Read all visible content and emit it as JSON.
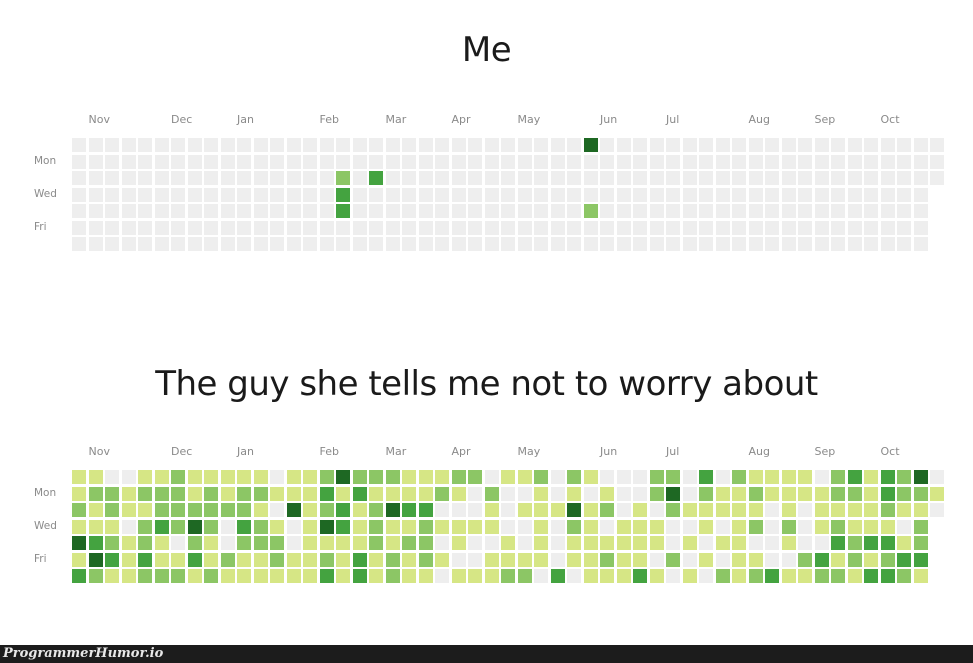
{
  "chart_data": [
    {
      "type": "heatmap",
      "title": "Me",
      "months": [
        "Nov",
        "Dec",
        "Jan",
        "Feb",
        "Mar",
        "Apr",
        "May",
        "Jun",
        "Jul",
        "Aug",
        "Sep",
        "Oct"
      ],
      "month_start_week": [
        1,
        6,
        10,
        15,
        19,
        23,
        27,
        32,
        36,
        41,
        45,
        49
      ],
      "weekday_labels": [
        {
          "row": 1,
          "label": "Mon"
        },
        {
          "row": 3,
          "label": "Wed"
        },
        {
          "row": 5,
          "label": "Fri"
        }
      ],
      "weeks": 53,
      "last_week_days": 3,
      "levels": [
        "#eeeeee",
        "#d6e685",
        "#8cc665",
        "#44a340",
        "#1e6823"
      ],
      "active_cells": [
        {
          "week": 16,
          "day": 2,
          "level": 2
        },
        {
          "week": 16,
          "day": 3,
          "level": 3
        },
        {
          "week": 16,
          "day": 4,
          "level": 3
        },
        {
          "week": 18,
          "day": 2,
          "level": 3
        },
        {
          "week": 31,
          "day": 0,
          "level": 4
        },
        {
          "week": 31,
          "day": 4,
          "level": 2
        }
      ]
    },
    {
      "type": "heatmap",
      "title": "The guy she tells me not to worry about",
      "months": [
        "Nov",
        "Dec",
        "Jan",
        "Feb",
        "Mar",
        "Apr",
        "May",
        "Jun",
        "Jul",
        "Aug",
        "Sep",
        "Oct"
      ],
      "month_start_week": [
        1,
        6,
        10,
        15,
        19,
        23,
        27,
        32,
        36,
        41,
        45,
        49
      ],
      "weekday_labels": [
        {
          "row": 1,
          "label": "Mon"
        },
        {
          "row": 3,
          "label": "Wed"
        },
        {
          "row": 5,
          "label": "Fri"
        }
      ],
      "weeks": 53,
      "last_week_days": 3,
      "levels": [
        "#eeeeee",
        "#d6e685",
        "#8cc665",
        "#44a340",
        "#1e6823"
      ],
      "grid": [
        [
          1,
          1,
          2,
          1,
          4,
          1,
          3
        ],
        [
          1,
          2,
          1,
          1,
          3,
          4,
          2
        ],
        [
          0,
          2,
          2,
          1,
          2,
          3,
          1
        ],
        [
          0,
          1,
          1,
          0,
          1,
          1,
          1
        ],
        [
          1,
          2,
          1,
          2,
          2,
          3,
          2
        ],
        [
          1,
          2,
          2,
          3,
          1,
          1,
          2
        ],
        [
          2,
          2,
          2,
          2,
          0,
          1,
          2
        ],
        [
          1,
          1,
          2,
          4,
          2,
          3,
          1
        ],
        [
          1,
          2,
          2,
          2,
          1,
          1,
          2
        ],
        [
          1,
          1,
          2,
          0,
          0,
          2,
          1
        ],
        [
          1,
          2,
          2,
          3,
          2,
          1,
          1
        ],
        [
          1,
          2,
          1,
          2,
          2,
          1,
          1
        ],
        [
          0,
          1,
          0,
          1,
          2,
          2,
          1
        ],
        [
          1,
          1,
          4,
          0,
          0,
          1,
          1
        ],
        [
          1,
          1,
          1,
          1,
          1,
          1,
          1
        ],
        [
          2,
          3,
          2,
          4,
          1,
          2,
          3
        ],
        [
          4,
          1,
          3,
          3,
          1,
          1,
          1
        ],
        [
          2,
          3,
          1,
          1,
          1,
          3,
          3
        ],
        [
          2,
          1,
          2,
          2,
          2,
          1,
          1
        ],
        [
          2,
          1,
          4,
          1,
          1,
          2,
          2
        ],
        [
          1,
          1,
          3,
          1,
          2,
          1,
          1
        ],
        [
          1,
          1,
          3,
          2,
          2,
          2,
          1
        ],
        [
          1,
          2,
          0,
          1,
          0,
          1,
          0
        ],
        [
          2,
          1,
          0,
          1,
          1,
          0,
          1
        ],
        [
          2,
          0,
          0,
          1,
          0,
          0,
          1
        ],
        [
          0,
          2,
          1,
          1,
          0,
          1,
          1
        ],
        [
          1,
          0,
          0,
          0,
          1,
          1,
          2
        ],
        [
          1,
          0,
          1,
          0,
          0,
          1,
          2
        ],
        [
          2,
          1,
          1,
          1,
          1,
          1,
          0
        ],
        [
          0,
          0,
          1,
          0,
          0,
          0,
          3
        ],
        [
          2,
          1,
          4,
          2,
          1,
          1,
          0
        ],
        [
          1,
          0,
          1,
          1,
          1,
          1,
          1
        ],
        [
          0,
          1,
          2,
          0,
          1,
          2,
          1
        ],
        [
          0,
          0,
          0,
          1,
          1,
          1,
          1
        ],
        [
          0,
          0,
          1,
          1,
          1,
          1,
          3
        ],
        [
          2,
          2,
          0,
          1,
          1,
          0,
          1
        ],
        [
          2,
          4,
          2,
          0,
          0,
          2,
          0
        ],
        [
          0,
          0,
          1,
          0,
          1,
          0,
          1
        ],
        [
          3,
          2,
          1,
          1,
          0,
          1,
          0
        ],
        [
          0,
          1,
          1,
          0,
          1,
          0,
          2
        ],
        [
          2,
          1,
          1,
          1,
          1,
          1,
          1
        ],
        [
          1,
          2,
          1,
          2,
          0,
          1,
          2
        ],
        [
          1,
          1,
          0,
          0,
          0,
          0,
          3
        ],
        [
          1,
          1,
          1,
          2,
          1,
          0,
          1
        ],
        [
          1,
          1,
          0,
          0,
          0,
          2,
          1
        ],
        [
          0,
          1,
          1,
          1,
          0,
          3,
          2
        ],
        [
          2,
          2,
          1,
          2,
          3,
          1,
          2
        ],
        [
          3,
          2,
          1,
          1,
          2,
          2,
          1
        ],
        [
          1,
          1,
          1,
          1,
          3,
          1,
          3
        ],
        [
          3,
          3,
          2,
          1,
          3,
          2,
          3
        ],
        [
          2,
          2,
          1,
          0,
          1,
          3,
          2
        ],
        [
          4,
          2,
          1,
          2,
          2,
          3,
          1
        ],
        [
          0,
          1,
          0
        ]
      ]
    }
  ],
  "footer": {
    "watermark": "ProgrammerHumor.io"
  }
}
